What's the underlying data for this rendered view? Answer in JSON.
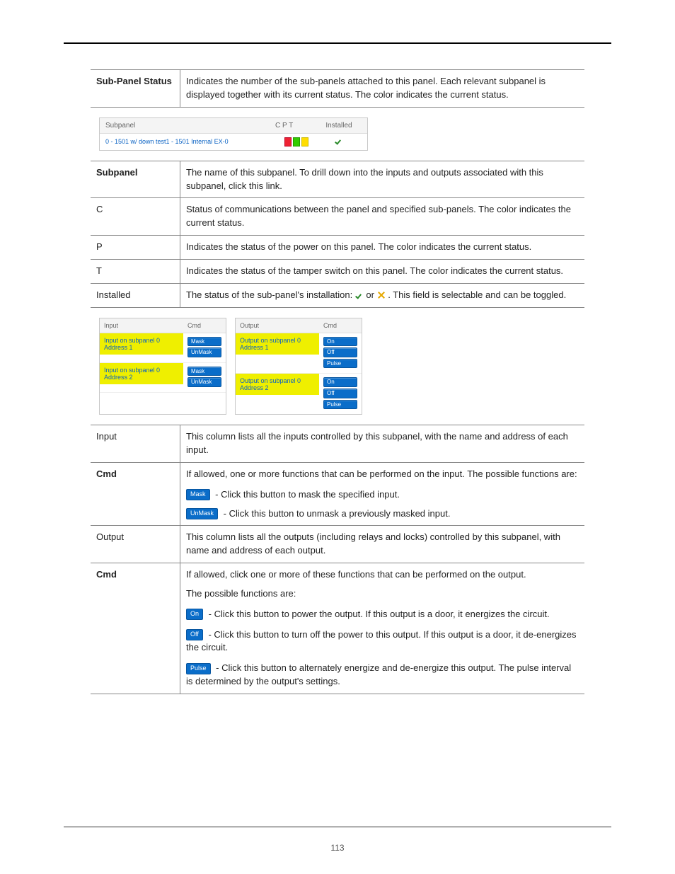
{
  "page_number": "113",
  "top_table": {
    "label": "Sub-Panel Status",
    "desc": "Indicates the number of the sub-panels attached to this panel. Each relevant subpanel is displayed together with its current status. The color indicates the current status."
  },
  "fig1": {
    "headers": {
      "subpanel": "Subpanel",
      "cpt": "C P T",
      "installed": "Installed"
    },
    "row": {
      "link": "0 - 1501 w/ down test1 - 1501 Internal EX-0"
    }
  },
  "mid_table": [
    {
      "label": "Subpanel",
      "bold": true,
      "desc": "The name of this subpanel. To drill down into the inputs and outputs associated with this subpanel, click this link."
    },
    {
      "label": "C",
      "bold": false,
      "desc": "Status of communications between the panel and specified sub-panels. The color indicates the current status."
    },
    {
      "label": "P",
      "bold": false,
      "desc": "Indicates the status of the power on this panel. The color indicates the current status."
    },
    {
      "label": "T",
      "bold": false,
      "desc": "Indicates the status of the tamper switch on this panel. The color indicates the current status."
    },
    {
      "label": "Installed",
      "bold": false,
      "desc_pre": "The status of the sub-panel's installation: ",
      "desc_mid": " or ",
      "desc_post": ". This field is selectable and can be toggled."
    }
  ],
  "fig2": {
    "input": {
      "header_name": "Input",
      "header_cmd": "Cmd",
      "rows": [
        {
          "name": "Input on subpanel 0 Address 1"
        },
        {
          "name": "Input on subpanel 0 Address 2"
        }
      ],
      "btn_mask": "Mask",
      "btn_unmask": "UnMask"
    },
    "output": {
      "header_name": "Output",
      "header_cmd": "Cmd",
      "rows": [
        {
          "name": "Output on subpanel 0 Address 1"
        },
        {
          "name": "Output on subpanel 0 Address 2"
        }
      ],
      "btn_on": "On",
      "btn_off": "Off",
      "btn_pulse": "Pulse"
    }
  },
  "bottom_table": {
    "input": {
      "label": "Input",
      "desc": "This column lists all the inputs controlled by this subpanel, with the name and address of each input."
    },
    "cmd_input": {
      "label": "Cmd",
      "intro": "If allowed, one or more functions that can be performed on the input. The possible functions are:",
      "mask_btn": "Mask",
      "mask_desc": " - Click this button to mask the specified input.",
      "unmask_btn": "UnMask",
      "unmask_desc": " - Click this button to unmask a previously masked input."
    },
    "output": {
      "label": "Output",
      "desc": "This column lists all the outputs (including relays and locks) controlled by this subpanel, with name and address of each output."
    },
    "cmd_output": {
      "label": "Cmd",
      "intro": "If allowed, click one or more of these functions that can be performed on the output.",
      "intro2": "The possible functions are:",
      "on_btn": "On",
      "on_desc": " - Click this button to power the output. If this output is a door, it energizes the circuit.",
      "off_btn": "Off",
      "off_desc": " - Click this button to turn off the power to this output. If this output is a door, it de-energizes the circuit.",
      "pulse_btn": "Pulse",
      "pulse_desc": " - Click this button to alternately energize and de-energize this output. The pulse interval is determined by the output's settings."
    }
  }
}
